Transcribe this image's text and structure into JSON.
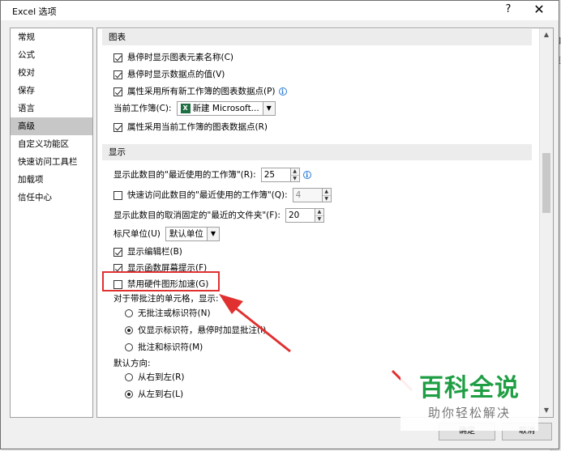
{
  "dialog": {
    "title": "Excel 选项",
    "help_glyph": "?",
    "close_glyph": "✕"
  },
  "background": {
    "right_labels": [
      "如",
      "頁"
    ]
  },
  "nav": {
    "items": [
      {
        "label": "常规",
        "selected": false
      },
      {
        "label": "公式",
        "selected": false
      },
      {
        "label": "校对",
        "selected": false
      },
      {
        "label": "保存",
        "selected": false
      },
      {
        "label": "语言",
        "selected": false
      },
      {
        "label": "高级",
        "selected": true
      },
      {
        "label": "自定义功能区",
        "selected": false
      },
      {
        "label": "快速访问工具栏",
        "selected": false
      },
      {
        "label": "加载项",
        "selected": false
      },
      {
        "label": "信任中心",
        "selected": false
      }
    ]
  },
  "chart_section": {
    "header": "图表",
    "opt_element_names": "悬停时显示图表元素名称(C)",
    "opt_data_values": "悬停时显示数据点的值(V)",
    "opt_all_new": "属性采用所有新工作簿的图表数据点(P)",
    "current_workbook_label": "当前工作簿(C):",
    "current_workbook_value": "新建 Microsoft...",
    "opt_current": "属性采用当前工作簿的图表数据点(R)"
  },
  "display_section": {
    "header": "显示",
    "recent_workbooks_label": "显示此数目的\"最近使用的工作簿\"(R):",
    "recent_workbooks_value": "25",
    "quick_access_label": "快速访问此数目的\"最近使用的工作簿\"(Q):",
    "quick_access_value": "4",
    "recent_folders_label": "显示此数目的取消固定的\"最近的文件夹\"(F):",
    "recent_folders_value": "20",
    "ruler_label": "标尺单位(U)",
    "ruler_value": "默认单位",
    "opt_formula_bar": "显示编辑栏(B)",
    "opt_function_tips": "显示函数屏幕提示(F)",
    "opt_disable_hw": "禁用硬件图形加速(G)",
    "comments_label": "对于带批注的单元格，显示:",
    "radio_none": "无批注或标识符(N)",
    "radio_indicator": "仅显示标识符，悬停时加显批注(I)",
    "radio_both": "批注和标识符(M)",
    "direction_label": "默认方向:",
    "radio_rtl": "从右到左(R)",
    "radio_ltr": "从左到右(L)"
  },
  "footer": {
    "ok": "确定",
    "cancel": "取消"
  },
  "watermark": {
    "main": "百科全说",
    "sub": "助你轻松解决"
  },
  "colors": {
    "highlight": "#e03030",
    "watermark_green": "#1f9e44",
    "selected_nav": "#c7c7c7"
  }
}
